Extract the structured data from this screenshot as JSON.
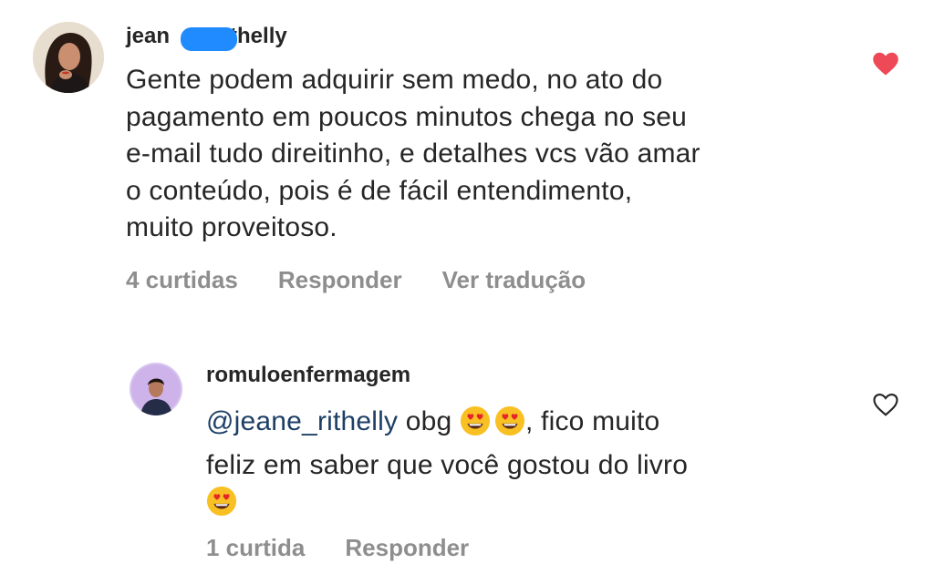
{
  "comment1": {
    "username_prefix": "jean",
    "username_suffix": "thelly",
    "lines": [
      "Gente podem adquirir sem medo, no ato do",
      "pagamento em poucos minutos chega no seu",
      "e-mail tudo direitinho, e detalhes vcs vão amar",
      "o conteúdo, pois é de fácil entendimento,",
      "muito proveitoso."
    ],
    "likes": "4 curtidas",
    "reply": "Responder",
    "translate": "Ver tradução",
    "liked": true
  },
  "reply1": {
    "username": "romuloenfermagem",
    "mention": "@jeane_rithelly",
    "text_after_mention": "obg",
    "text_after_emojis": ", fico muito",
    "line2": "feliz em saber que você gostou do livro",
    "likes": "1 curtida",
    "reply": "Responder",
    "liked": false
  },
  "colors": {
    "text": "#262626",
    "muted": "#8e8e8e",
    "mention": "#1d3f66",
    "heart_liked": "#ed4956",
    "redaction": "#1f8bff"
  },
  "icons": {
    "comment_like": "heart-filled-icon",
    "reply_like": "heart-outline-icon",
    "emoji": "heart-eyes-emoji"
  }
}
